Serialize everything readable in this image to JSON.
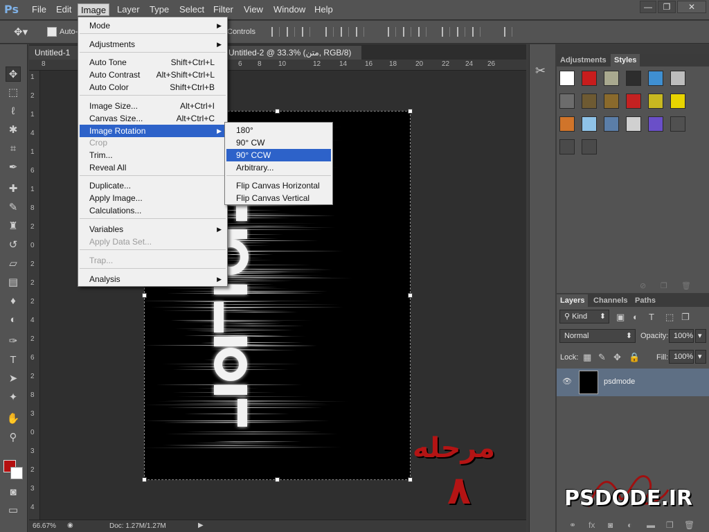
{
  "app": {
    "logo": "Ps"
  },
  "menubar": {
    "items": [
      "File",
      "Edit",
      "Image",
      "Layer",
      "Type",
      "Select",
      "Filter",
      "View",
      "Window",
      "Help"
    ],
    "active": "Image"
  },
  "window_controls": {
    "minimize": "—",
    "restore": "❐",
    "close": "✕"
  },
  "options_bar": {
    "auto_select_label": "Auto-",
    "show_controls_label": "Controls"
  },
  "tabs": [
    {
      "label": "Untitled-1"
    },
    {
      "label": "Untitled-2 @ 33.3% (متن, RGB/8) *",
      "close": "×"
    }
  ],
  "ruler_top": [
    "8",
    "6",
    "8",
    "10",
    "12",
    "14",
    "16",
    "18",
    "20",
    "22",
    "24",
    "26"
  ],
  "ruler_left": [
    "1",
    "2",
    "1",
    "4",
    "1",
    "6",
    "1",
    "8",
    "2",
    "0",
    "2",
    "2",
    "2",
    "4",
    "2",
    "6",
    "2",
    "8",
    "3",
    "0",
    "3",
    "2",
    "3",
    "4"
  ],
  "image_menu": {
    "mode": "Mode",
    "adjustments": "Adjustments",
    "auto_tone": {
      "label": "Auto Tone",
      "shortcut": "Shift+Ctrl+L"
    },
    "auto_contrast": {
      "label": "Auto Contrast",
      "shortcut": "Alt+Shift+Ctrl+L"
    },
    "auto_color": {
      "label": "Auto Color",
      "shortcut": "Shift+Ctrl+B"
    },
    "image_size": {
      "label": "Image Size...",
      "shortcut": "Alt+Ctrl+I"
    },
    "canvas_size": {
      "label": "Canvas Size...",
      "shortcut": "Alt+Ctrl+C"
    },
    "image_rotation": "Image Rotation",
    "crop": "Crop",
    "trim": "Trim...",
    "reveal_all": "Reveal All",
    "duplicate": "Duplicate...",
    "apply_image": "Apply Image...",
    "calculations": "Calculations...",
    "variables": "Variables",
    "apply_data_set": "Apply Data Set...",
    "trap": "Trap...",
    "analysis": "Analysis"
  },
  "rotation_submenu": [
    "180°",
    "90° CW",
    "90° CCW",
    "Arbitrary...",
    "Flip Canvas Horizontal",
    "Flip Canvas Vertical"
  ],
  "styles_panel": {
    "tabs": [
      "Adjustments",
      "Styles"
    ],
    "active_tab": "Styles"
  },
  "style_swatches": [
    "#ffffff",
    "#c81d1d",
    "#a9a98f",
    "#2d2d2d",
    "#3f8fd1",
    "#bdbdbd",
    "#6c6c6c",
    "#6e5a32",
    "#8a6a2c",
    "#c42121",
    "#c8b820",
    "#e8d400",
    "#d0742a",
    "#8fc3e8",
    "#5b7ea8",
    "#d0d0d0",
    "#6a4fc8",
    "#505050",
    "#4a4a4a",
    "#4a4a4a"
  ],
  "layers_panel": {
    "tabs": [
      "Layers",
      "Channels",
      "Paths"
    ],
    "active_tab": "Layers",
    "kind_label": "Kind",
    "blend_mode": "Normal",
    "opacity_label": "Opacity:",
    "opacity_value": "100%",
    "lock_label": "Lock:",
    "fill_label": "Fill:",
    "fill_value": "100%",
    "layer_name": "psdmode"
  },
  "status_bar": {
    "zoom": "66.67%",
    "doc": "Doc: 1.27M/1.27M"
  },
  "overlay": {
    "step_text": "مرحله",
    "step_number": "٨",
    "site_logo": "PSDODE.IR"
  }
}
